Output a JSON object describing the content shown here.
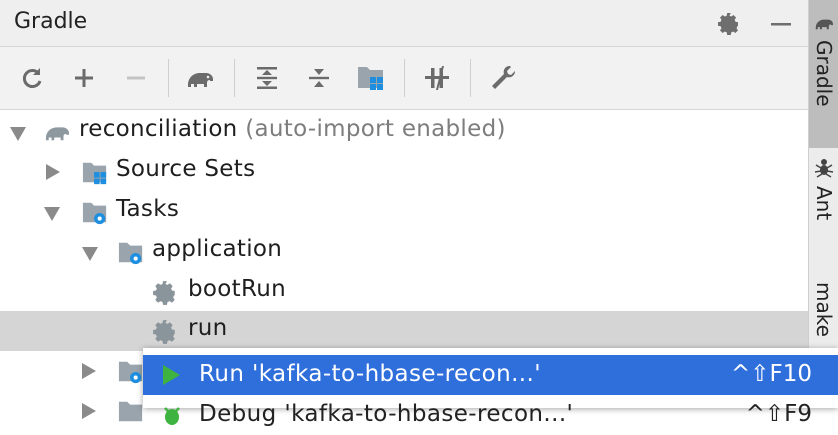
{
  "panel": {
    "title": "Gradle"
  },
  "toolbar": {
    "items": [
      "refresh-icon",
      "plus-icon",
      "minus-icon",
      "gradle-elephant-icon",
      "expand-all-icon",
      "collapse-all-icon",
      "source-sets-icon",
      "toggle-offline-icon",
      "wrench-icon"
    ]
  },
  "tree": {
    "project": {
      "name": "reconciliation",
      "hint": "(auto-import enabled)"
    },
    "source_sets": "Source Sets",
    "tasks": "Tasks",
    "application": "application",
    "boot_run": "bootRun",
    "run": "run"
  },
  "side_tabs": [
    {
      "label": "Gradle"
    },
    {
      "label": "Ant"
    },
    {
      "label": "make"
    }
  ],
  "context_menu": {
    "items": [
      {
        "label": "Run 'kafka-to-hbase-recon...'",
        "shortcut": "^⇧F10"
      },
      {
        "label": "Debug 'kafka-to-hbase-recon...'",
        "shortcut": "^⇧F9"
      }
    ]
  },
  "colors": {
    "accent": "#2f6fdc",
    "run_green": "#3fb33f",
    "selection": "#d5d5d5",
    "folder_blue": "#1e8fe0"
  }
}
